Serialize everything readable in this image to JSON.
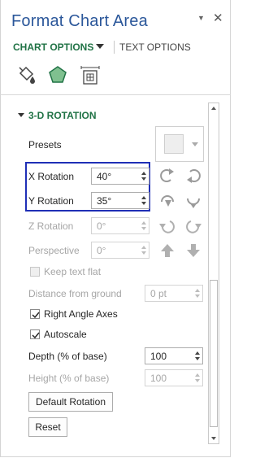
{
  "panel": {
    "title": "Format Chart Area",
    "tabs": [
      "CHART OPTIONS",
      "TEXT OPTIONS"
    ]
  },
  "icons": [
    "fill-bucket-icon",
    "pentagon-effects-icon",
    "size-properties-icon"
  ],
  "section": {
    "title": "3-D ROTATION",
    "presets_label": "Presets",
    "x_rotation": {
      "label": "X Rotation",
      "value": "40°"
    },
    "y_rotation": {
      "label": "Y Rotation",
      "value": "35°"
    },
    "z_rotation": {
      "label": "Z Rotation",
      "value": "0°"
    },
    "perspective": {
      "label": "Perspective",
      "value": "0°"
    },
    "keep_text_flat": {
      "label": "Keep text flat",
      "checked": false,
      "disabled": true
    },
    "distance_from_ground": {
      "label": "Distance from ground",
      "value": "0 pt"
    },
    "right_angle_axes": {
      "label": "Right Angle Axes",
      "checked": true
    },
    "autoscale": {
      "label": "Autoscale",
      "checked": true
    },
    "depth": {
      "label": "Depth (% of base)",
      "value": "100"
    },
    "height": {
      "label": "Height (% of base)",
      "value": "100"
    },
    "default_rotation_label": "Default Rotation",
    "reset_label": "Reset"
  },
  "colors": {
    "title": "#2b579a",
    "accent": "#217346",
    "highlight": "#1f2fb6"
  }
}
